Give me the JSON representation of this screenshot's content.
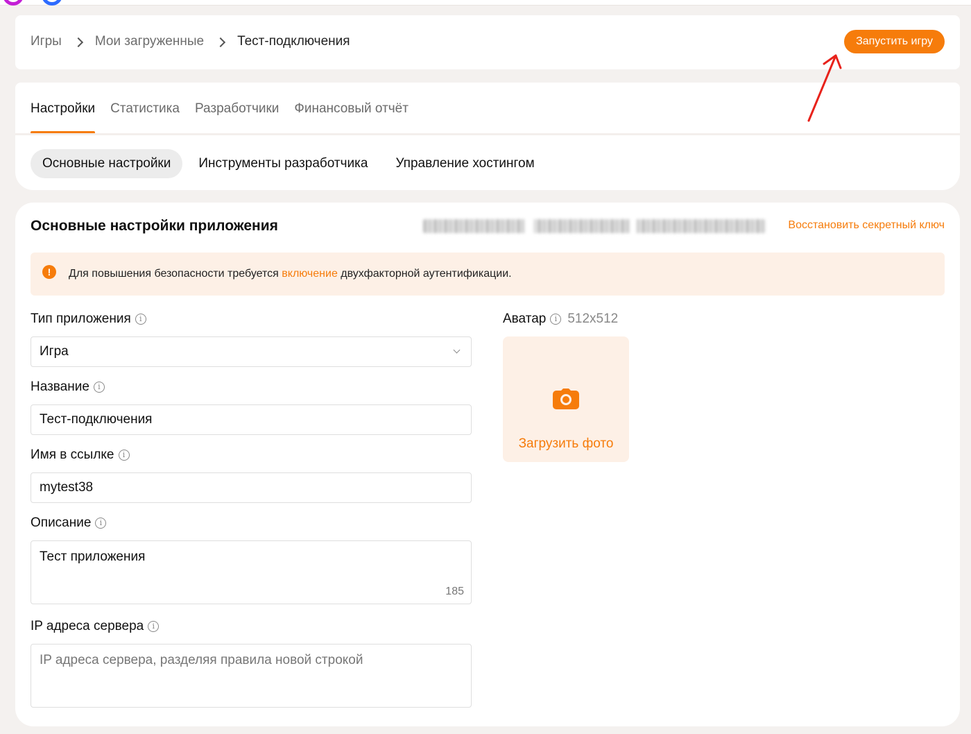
{
  "breadcrumb": {
    "items": [
      "Игры",
      "Мои загруженные",
      "Тест-подключения"
    ]
  },
  "header": {
    "launch_label": "Запустить игру"
  },
  "tabs": [
    "Настройки",
    "Статистика",
    "Разработчики",
    "Финансовый отчёт"
  ],
  "subtabs": [
    "Основные настройки",
    "Инструменты разработчика",
    "Управление хостингом"
  ],
  "section": {
    "title": "Основные настройки приложения",
    "restore_key_label": "Восстановить секретный ключ"
  },
  "alert": {
    "icon_glyph": "!",
    "text_before": "Для повышения безопасности требуется ",
    "link": "включение",
    "text_after": " двухфакторной аутентификации."
  },
  "form": {
    "type": {
      "label": "Тип приложения",
      "value": "Игра"
    },
    "name": {
      "label": "Название",
      "value": "Тест-подключения"
    },
    "slug": {
      "label": "Имя в ссылке",
      "value": "mytest38"
    },
    "description": {
      "label": "Описание",
      "value": "Тест приложения",
      "counter": "185"
    },
    "ip": {
      "label": "IP адреса сервера",
      "placeholder": "IP адреса сервера, разделяя правила новой строкой"
    }
  },
  "avatar": {
    "label": "Аватар",
    "size": "512x512",
    "upload_label": "Загрузить фото"
  },
  "info_glyph": "i",
  "colors": {
    "accent": "#f67c0b",
    "accent_bg": "#fdf0e6",
    "page_bg": "#f4f1ef",
    "annotation_arrow": "#e8221b"
  },
  "icons": [
    "chevron-right-icon",
    "chevron-down-icon",
    "warning-icon",
    "info-icon",
    "camera-icon"
  ]
}
